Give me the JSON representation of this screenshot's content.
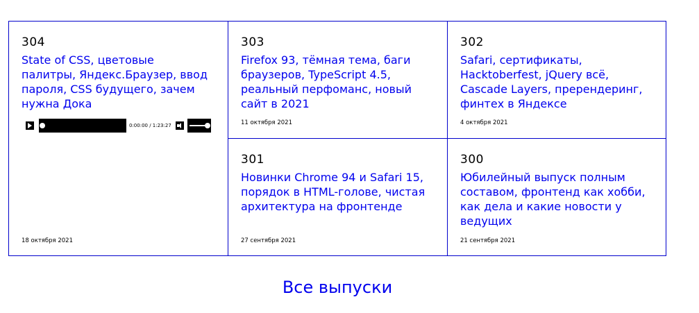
{
  "colors": {
    "accent": "#0000ee",
    "border": "#0000cc"
  },
  "episodes": [
    {
      "number": "304",
      "title": "State of CSS, цветовые палитры, Яндекс.Браузер, ввод пароля, CSS будущего, зачем нужна Дока",
      "date": "18 октября 2021"
    },
    {
      "number": "303",
      "title": "Firefox 93, тёмная тема, баги браузеров, TypeScript 4.5, реальный перфоманс, новый сайт в 2021",
      "date": "11 октября 2021"
    },
    {
      "number": "302",
      "title": "Safari, сертификаты, Hacktoberfest, jQuery всё, Cascade Layers, пререндеринг, финтех в Яндексе",
      "date": "4 октября 2021"
    },
    {
      "number": "301",
      "title": "Новинки Chrome 94 и Safari 15, порядок в HTML-голове, чистая архитектура на фронтенде",
      "date": "27 сентября 2021"
    },
    {
      "number": "300",
      "title": "Юбилейный выпуск полным составом, фронтенд как хобби, как дела и какие новости у ведущих",
      "date": "21 сентября 2021"
    }
  ],
  "player": {
    "time": "0:00:00 / 1:23:27",
    "progress_fraction": 0,
    "volume_fraction": 1,
    "icons": {
      "play": "play-icon",
      "volume": "volume-icon"
    }
  },
  "all_episodes_label": "Все выпуски"
}
